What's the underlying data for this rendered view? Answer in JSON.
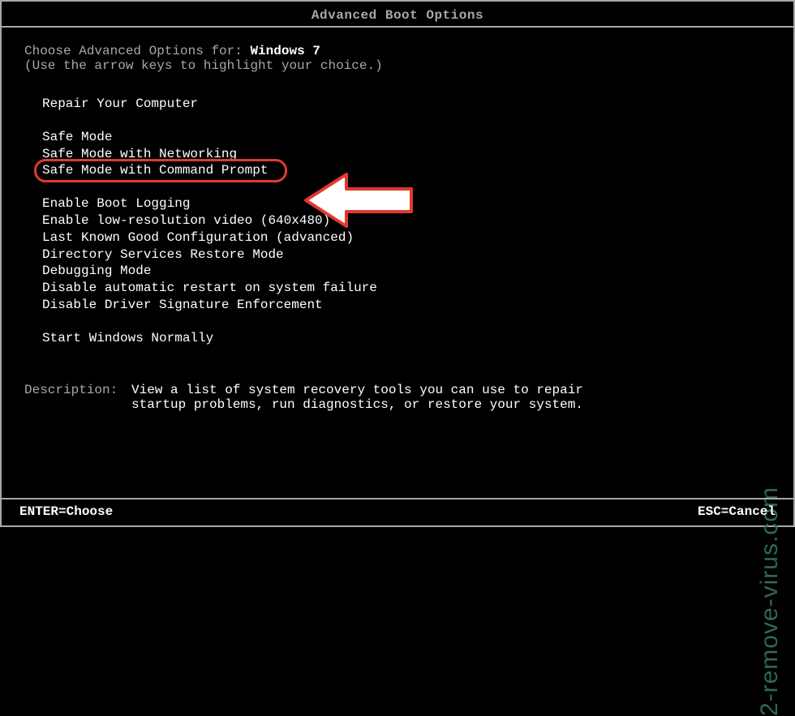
{
  "title": "Advanced Boot Options",
  "intro": {
    "prefix": "Choose Advanced Options for: ",
    "os": "Windows 7",
    "hint": "(Use the arrow keys to highlight your choice.)"
  },
  "menu": {
    "group1": [
      "Repair Your Computer"
    ],
    "group2": [
      "Safe Mode",
      "Safe Mode with Networking",
      "Safe Mode with Command Prompt"
    ],
    "group3": [
      "Enable Boot Logging",
      "Enable low-resolution video (640x480)",
      "Last Known Good Configuration (advanced)",
      "Directory Services Restore Mode",
      "Debugging Mode",
      "Disable automatic restart on system failure",
      "Disable Driver Signature Enforcement"
    ],
    "group4": [
      "Start Windows Normally"
    ],
    "highlighted_index_group2": 2
  },
  "description": {
    "label": "Description:",
    "text": "View a list of system recovery tools you can use to repair startup problems, run diagnostics, or restore your system."
  },
  "footer": {
    "left": "ENTER=Choose",
    "right": "ESC=Cancel"
  },
  "watermark": "2-remove-virus.com",
  "colors": {
    "highlight_border": "#e03a2f",
    "arrow_fill": "#ffffff",
    "watermark": "#2e6a4e"
  }
}
